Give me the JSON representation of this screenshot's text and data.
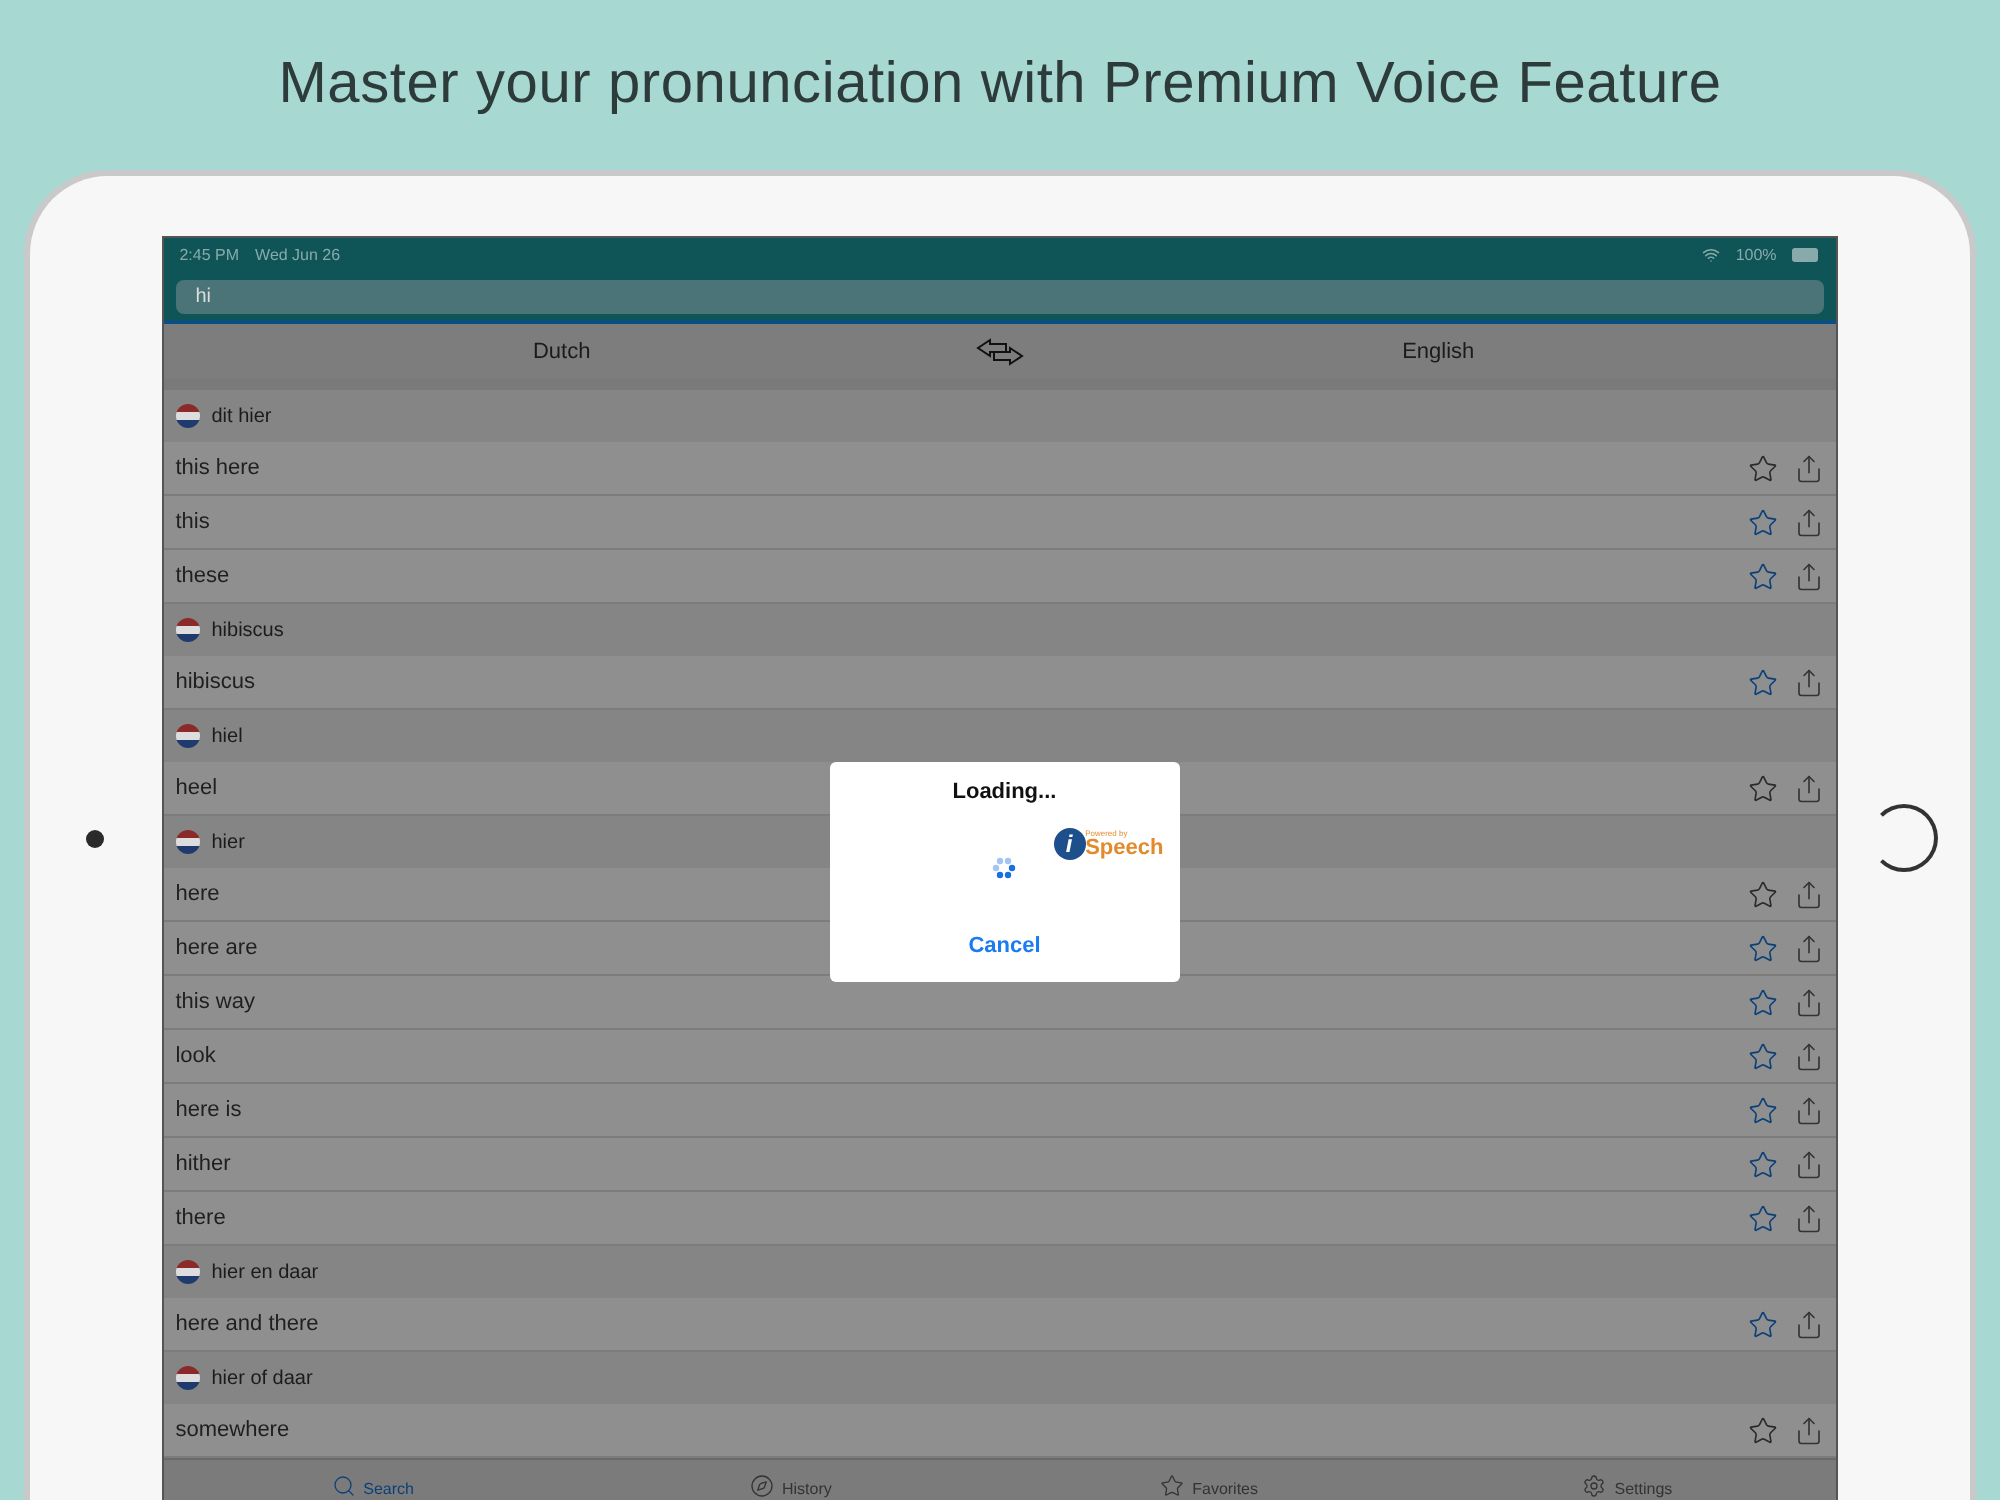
{
  "headline": "Master your pronunciation with Premium Voice Feature",
  "status_bar": {
    "time": "2:45 PM",
    "date": "Wed Jun 26",
    "battery": "100%"
  },
  "search": {
    "value": "hi"
  },
  "languages": {
    "source": "Dutch",
    "target": "English"
  },
  "entries": [
    {
      "kind": "heading",
      "text": "dit hier"
    },
    {
      "kind": "item",
      "text": "this here",
      "favorite": false
    },
    {
      "kind": "item",
      "text": "this",
      "favorite": true
    },
    {
      "kind": "item",
      "text": "these",
      "favorite": true
    },
    {
      "kind": "heading",
      "text": "hibiscus"
    },
    {
      "kind": "item",
      "text": "hibiscus",
      "favorite": true
    },
    {
      "kind": "heading",
      "text": "hiel"
    },
    {
      "kind": "item",
      "text": "heel",
      "favorite": false
    },
    {
      "kind": "heading",
      "text": "hier"
    },
    {
      "kind": "item",
      "text": "here",
      "favorite": false
    },
    {
      "kind": "item",
      "text": "here are",
      "favorite": true
    },
    {
      "kind": "item",
      "text": "this way",
      "favorite": true
    },
    {
      "kind": "item",
      "text": "look",
      "favorite": true
    },
    {
      "kind": "item",
      "text": "here is",
      "favorite": true
    },
    {
      "kind": "item",
      "text": "hither",
      "favorite": true
    },
    {
      "kind": "item",
      "text": "there",
      "favorite": true
    },
    {
      "kind": "heading",
      "text": "hier en daar"
    },
    {
      "kind": "item",
      "text": "here and there",
      "favorite": true
    },
    {
      "kind": "heading",
      "text": "hier of daar"
    },
    {
      "kind": "item",
      "text": "somewhere",
      "favorite": false
    }
  ],
  "dialog": {
    "title": "Loading...",
    "logo_caption": "Powered by",
    "logo_text": "Speech",
    "logo_letter": "i",
    "cancel": "Cancel"
  },
  "tabs": [
    {
      "label": "Search",
      "selected": true
    },
    {
      "label": "History",
      "selected": false
    },
    {
      "label": "Favorites",
      "selected": false
    },
    {
      "label": "Settings",
      "selected": false
    }
  ]
}
